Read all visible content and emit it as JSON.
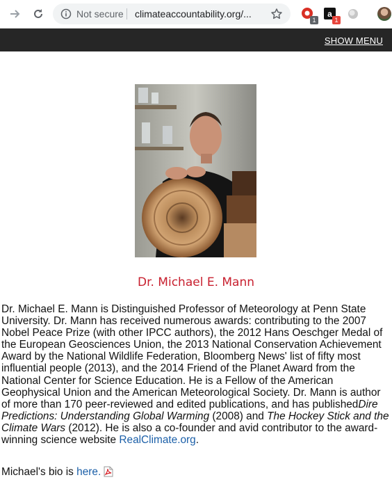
{
  "browser": {
    "security_label": "Not secure",
    "url": "climateaccountability.org/...",
    "extensions": [
      {
        "name": "ext-red",
        "badge": "1"
      },
      {
        "name": "ext-amazon",
        "badge": "1"
      },
      {
        "name": "ext-gray"
      }
    ]
  },
  "header": {
    "menu_label": "SHOW MENU"
  },
  "person": {
    "name": "Dr. Michael E. Mann"
  },
  "bio": {
    "p1": "Dr. Michael E. Mann is Distinguished Professor of Meteorology at Penn State University. Dr. Mann has received numerous awards: contributing to the 2007 Nobel Peace Prize (with other IPCC authors), the 2012 Hans Oeschger Medal of the European Geosciences Union, the 2013 National Conservation Achievement Award by the National Wildlife Federation, Bloomberg News' list of fifty most influential people (2013), and the 2014 Friend of the Planet Award from the National Center for Science Education. He is a Fellow of the American Geophysical Union and the American Meteorological Society. Dr. Mann is author of more than 170 peer-reviewed and edited publications, and has published",
    "book1": "Dire Predictions: Understanding Global Warming",
    "mid1": " (2008) and ",
    "book2": "The Hockey Stick and the Climate Wars",
    "mid2": " (2012). He is also a co-founder and avid contributor to the award-winning science website ",
    "site_link": "RealClimate.org",
    "end": ".",
    "bio_prefix": "Michael's bio is ",
    "bio_link": "here."
  },
  "colors": {
    "header_bg": "#262626",
    "name": "#c8202f",
    "link": "#1b5fa8"
  }
}
